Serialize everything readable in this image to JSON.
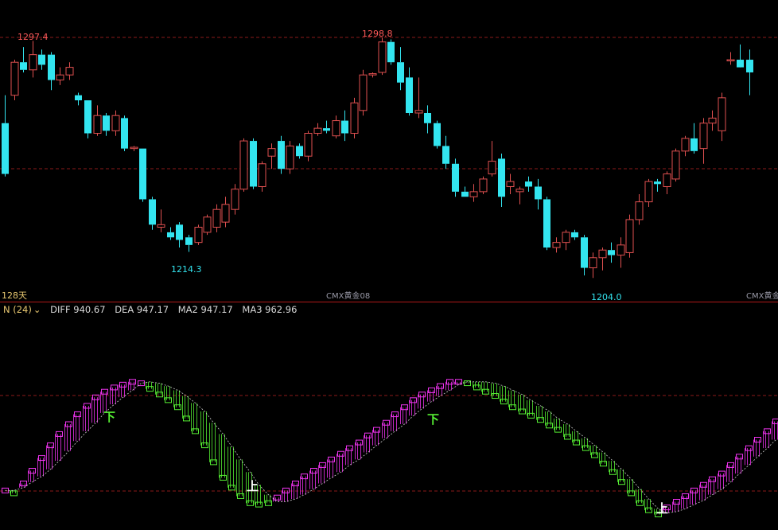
{
  "colors": {
    "background": "#000000",
    "up": "#e05050",
    "down": "#33e5f0",
    "grid": "#8b1a1a",
    "separator": "#b01818",
    "indicator_up": "#ee33ee",
    "indicator_down": "#55ee33",
    "signal_sell": "#55ee33",
    "signal_buy": "#ffffff"
  },
  "price_panel": {
    "high1": "1297.4",
    "high2": "1298.8",
    "low1": "1214.3",
    "low2": "1204.0",
    "days_label": "128天",
    "symbol1": "CMX黄金08",
    "symbol2": "CMX黄金"
  },
  "indicator_panel": {
    "name": "N (24)",
    "dropdown_icon": "triangle-down-icon",
    "diff": "DIFF 940.67",
    "dea": "DEA 947.17",
    "ma2": "MA2 947.17",
    "ma3": "MA3 962.96",
    "sell_signal": "下",
    "buy_signal": "上"
  },
  "chart_data": [
    {
      "type": "candlestick",
      "ylim": [
        1195,
        1306
      ],
      "grid": true,
      "ohlc": [
        [
          1265,
          1276,
          1244,
          1245
        ],
        [
          1276,
          1290,
          1274,
          1289
        ],
        [
          1289,
          1295,
          1285,
          1286
        ],
        [
          1286,
          1297.4,
          1283,
          1292
        ],
        [
          1292,
          1294,
          1286,
          1288
        ],
        [
          1292,
          1293,
          1278,
          1282
        ],
        [
          1282,
          1287,
          1280,
          1284
        ],
        [
          1284,
          1289,
          1282,
          1287
        ],
        [
          1276,
          1277,
          1272,
          1274
        ],
        [
          1274,
          1274,
          1259,
          1261
        ],
        [
          1261,
          1272,
          1260,
          1268
        ],
        [
          1268,
          1269,
          1260,
          1262
        ],
        [
          1262,
          1270,
          1260,
          1268
        ],
        [
          1267,
          1268,
          1254,
          1255
        ],
        [
          1255,
          1256,
          1254,
          1255.5
        ],
        [
          1255,
          1255,
          1234,
          1235
        ],
        [
          1235,
          1236,
          1223,
          1225
        ],
        [
          1224,
          1231,
          1222,
          1225
        ],
        [
          1222,
          1224,
          1219,
          1220
        ],
        [
          1225,
          1226,
          1216,
          1219
        ],
        [
          1220,
          1221,
          1214.3,
          1217
        ],
        [
          1218,
          1225,
          1217,
          1224
        ],
        [
          1222,
          1229,
          1221,
          1228
        ],
        [
          1224,
          1233,
          1222,
          1231
        ],
        [
          1226,
          1236,
          1224,
          1233
        ],
        [
          1231,
          1241,
          1229,
          1239
        ],
        [
          1239,
          1259,
          1238,
          1258
        ],
        [
          1258,
          1259,
          1239,
          1240
        ],
        [
          1240,
          1250,
          1238,
          1249
        ],
        [
          1252,
          1257,
          1247,
          1255
        ],
        [
          1258,
          1260,
          1245,
          1247
        ],
        [
          1247,
          1258,
          1245,
          1256
        ],
        [
          1256,
          1257,
          1251,
          1252
        ],
        [
          1252,
          1262,
          1250,
          1261
        ],
        [
          1261,
          1265,
          1260,
          1263
        ],
        [
          1263,
          1266,
          1261,
          1262
        ],
        [
          1260,
          1268,
          1259,
          1266
        ],
        [
          1266,
          1270,
          1258,
          1261
        ],
        [
          1261,
          1275,
          1259,
          1273
        ],
        [
          1270,
          1286,
          1268,
          1284
        ],
        [
          1284,
          1285,
          1283,
          1284.5
        ],
        [
          1285,
          1298.8,
          1284,
          1297
        ],
        [
          1297,
          1298,
          1288,
          1289
        ],
        [
          1289,
          1295,
          1278,
          1281
        ],
        [
          1283,
          1287,
          1268,
          1269
        ],
        [
          1269,
          1283,
          1267,
          1270
        ],
        [
          1269,
          1272,
          1261,
          1265
        ],
        [
          1265,
          1266,
          1255,
          1256
        ],
        [
          1256,
          1260,
          1247,
          1249
        ],
        [
          1249,
          1251,
          1236,
          1238
        ],
        [
          1238,
          1240,
          1236,
          1236
        ],
        [
          1236,
          1241,
          1234,
          1238
        ],
        [
          1238,
          1244,
          1237,
          1243
        ],
        [
          1245,
          1258,
          1244,
          1250
        ],
        [
          1251,
          1253,
          1232,
          1236
        ],
        [
          1240,
          1245,
          1237,
          1242
        ],
        [
          1238,
          1240,
          1233,
          1239
        ],
        [
          1242,
          1244,
          1238,
          1240
        ],
        [
          1240,
          1243,
          1231,
          1235
        ],
        [
          1235,
          1236,
          1215,
          1216
        ],
        [
          1216,
          1220,
          1214,
          1218
        ],
        [
          1218,
          1223,
          1215,
          1222
        ],
        [
          1222,
          1223,
          1219,
          1220
        ],
        [
          1220,
          1221,
          1205,
          1208
        ],
        [
          1208,
          1214,
          1204,
          1212
        ],
        [
          1212,
          1216,
          1207,
          1215
        ],
        [
          1215,
          1218,
          1210,
          1213
        ],
        [
          1213,
          1220,
          1208,
          1217
        ],
        [
          1214,
          1229,
          1212,
          1227
        ],
        [
          1227,
          1237,
          1225,
          1234
        ],
        [
          1234,
          1243,
          1232,
          1242
        ],
        [
          1242,
          1243,
          1238,
          1241
        ],
        [
          1240,
          1246,
          1237,
          1245
        ],
        [
          1243,
          1255,
          1242,
          1254
        ],
        [
          1254,
          1260,
          1252,
          1259
        ],
        [
          1259,
          1265,
          1253,
          1254
        ],
        [
          1255,
          1267,
          1249,
          1265
        ],
        [
          1265,
          1270,
          1262,
          1267
        ],
        [
          1262,
          1277,
          1258,
          1275
        ],
        [
          1290,
          1293,
          1288,
          1290
        ],
        [
          1290,
          1296,
          1289,
          1287
        ],
        [
          1290,
          1294,
          1276,
          1285
        ]
      ]
    },
    {
      "type": "indicator-bars",
      "series": [
        {
          "name": "DIFF",
          "values": [
            878,
            876,
            883,
            892,
            901,
            910,
            918,
            925,
            932,
            938,
            944,
            948,
            951,
            953,
            955,
            954,
            950,
            946,
            942,
            937,
            929,
            920,
            910,
            898,
            887,
            880,
            874,
            869,
            868,
            869,
            873,
            878,
            883,
            888,
            892,
            896,
            900,
            904,
            908,
            912,
            917,
            921,
            926,
            932,
            937,
            942,
            946,
            949,
            952,
            955,
            955,
            954,
            951,
            948,
            945,
            941,
            937,
            934,
            931,
            928,
            924,
            921,
            916,
            912,
            908,
            903,
            897,
            891,
            884,
            876,
            869,
            864,
            861,
            866,
            870,
            874,
            878,
            882,
            886,
            890,
            896,
            902,
            908,
            914,
            920,
            927
          ]
        },
        {
          "name": "DEA",
          "values": [
            878,
            878,
            880,
            884,
            888,
            893,
            899,
            906,
            913,
            920,
            926,
            933,
            939,
            944,
            949,
            954,
            955,
            954,
            952,
            949,
            945,
            940,
            934,
            926,
            918,
            909,
            900,
            891,
            882,
            875,
            870,
            870,
            872,
            875,
            879,
            883,
            887,
            891,
            896,
            900,
            905,
            910,
            915,
            920,
            925,
            931,
            936,
            941,
            945,
            949,
            953,
            955,
            955,
            955,
            954,
            952,
            949,
            946,
            942,
            938,
            934,
            929,
            925,
            920,
            915,
            910,
            905,
            899,
            893,
            886,
            879,
            872,
            865,
            862,
            863,
            865,
            868,
            871,
            875,
            879,
            884,
            890,
            896,
            902,
            908,
            914
          ]
        }
      ],
      "ylim": [
        850,
        1000
      ],
      "grid": true
    }
  ]
}
